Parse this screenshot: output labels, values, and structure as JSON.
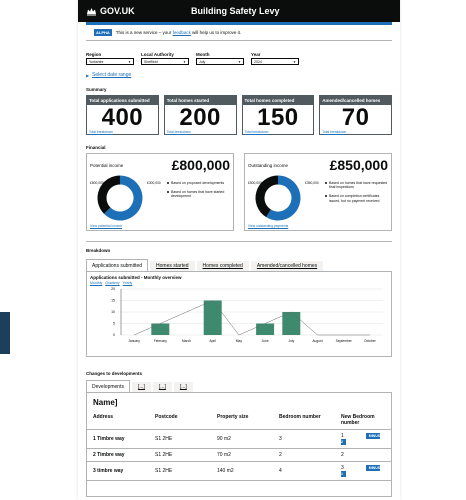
{
  "header": {
    "logo_text": "GOV.UK",
    "service_name": "Building Safety Levy"
  },
  "phase_banner": {
    "tag": "ALPHA",
    "text_before": "This is a new service – your ",
    "link": "feedback",
    "text_after": " will help us to improve it."
  },
  "filters": [
    {
      "label": "Region",
      "value": "Yorkshire"
    },
    {
      "label": "Local Authority",
      "value": "Sheffield"
    },
    {
      "label": "Month",
      "value": "July"
    },
    {
      "label": "Year",
      "value": "2024"
    }
  ],
  "date_range_link": "Select date range",
  "summary": {
    "title": "Summary",
    "cards": [
      {
        "title": "Total applications submitted",
        "value": "400",
        "link": "Total breakdown"
      },
      {
        "title": "Total homes started",
        "value": "200",
        "link": "Total breakdown"
      },
      {
        "title": "Total homes completed",
        "value": "150",
        "link": "Total breakdown"
      },
      {
        "title": "Amended/cancelled homes",
        "value": "70",
        "link": "Total breakdown"
      }
    ]
  },
  "financial": {
    "title": "Financial",
    "panels": [
      {
        "label": "Potential income",
        "amount": "£800,000",
        "donut_left_label": "£500,000",
        "donut_right_label": "£300,000",
        "legend": [
          "Based on proposed developments",
          "Based on homes that have started development"
        ],
        "link": "View potential income",
        "fractions": [
          0.625,
          0.375
        ]
      },
      {
        "label": "Outstanding income",
        "amount": "£850,000",
        "donut_left_label": "£500,000",
        "donut_right_label": "£350,000",
        "legend": [
          "Based on homes that have requested final inspections",
          "Based on completion certificates issued, but no payment received"
        ],
        "link": "View outstanding payments",
        "fractions": [
          0.588,
          0.412
        ]
      }
    ]
  },
  "breakdown": {
    "title": "Breakdown",
    "tabs": [
      "Applications submitted",
      "Homes started",
      "Homes completed",
      "Amended/cancelled homes"
    ],
    "chart_title": "Applications submitted - Monthly overview",
    "chart_links": [
      "Monthly",
      "Quarterly",
      "Yearly"
    ]
  },
  "chart_data": {
    "type": "bar",
    "categories": [
      "January",
      "February",
      "March",
      "April",
      "May",
      "June",
      "July",
      "August",
      "September",
      "October"
    ],
    "values": [
      0,
      5,
      0,
      15,
      0,
      5,
      10,
      0,
      0,
      0
    ],
    "line_values": [
      0,
      5,
      10,
      15,
      0,
      5,
      10,
      0,
      0,
      0
    ],
    "yticks": [
      "0",
      "5",
      "10",
      "15",
      "20"
    ],
    "ylim": [
      0,
      20
    ],
    "bar_color": "#3e8a6f",
    "line_color": "#626a6e"
  },
  "changes": {
    "title": "Changes to developments",
    "tabs": [
      "Developments",
      "[...]",
      "[...]",
      "[...]"
    ],
    "table_title": "Name]",
    "columns": [
      "Address",
      "Postcode",
      "Property size",
      "Bedroom number",
      "New Bedroom number"
    ],
    "rows": [
      {
        "address": "1 Timbre way",
        "postcode": "S1 2HE",
        "size": "90 m2",
        "bedrooms": "3",
        "new_bedrooms": "1",
        "badge": "MINUS 2"
      },
      {
        "address": "2 Timbre way",
        "postcode": "S1 2HE",
        "size": "70 m2",
        "bedrooms": "2",
        "new_bedrooms": "2",
        "badge": ""
      },
      {
        "address": "3 timbre way",
        "postcode": "S1 2HE",
        "size": "140 m2",
        "bedrooms": "4",
        "new_bedrooms": "3",
        "badge": "MINUS 1"
      }
    ]
  },
  "colors": {
    "blue": "#1d70b8",
    "black": "#0b0c0c",
    "grey": "#505a5f",
    "green": "#3e8a6f"
  }
}
